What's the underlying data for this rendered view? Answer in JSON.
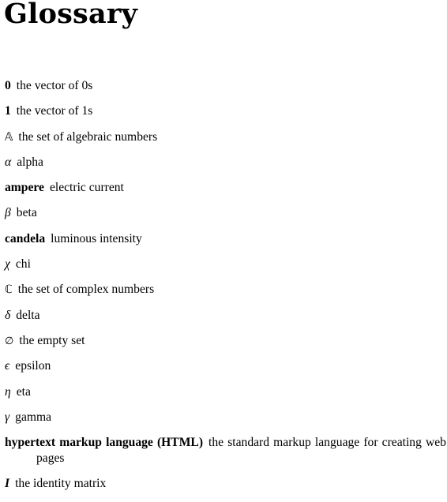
{
  "title": "Glossary",
  "entries": [
    {
      "term": "0",
      "description": "the vector of 0s",
      "style": "bold"
    },
    {
      "term": "1",
      "description": "the vector of 1s",
      "style": "bold"
    },
    {
      "term": "𝔸",
      "description": "the set of algebraic numbers",
      "style": "bb"
    },
    {
      "term": "α",
      "description": "alpha",
      "style": "math"
    },
    {
      "term": "ampere",
      "description": "electric current",
      "style": "bold"
    },
    {
      "term": "β",
      "description": "beta",
      "style": "math"
    },
    {
      "term": "candela",
      "description": "luminous intensity",
      "style": "bold"
    },
    {
      "term": "χ",
      "description": "chi",
      "style": "math"
    },
    {
      "term": "ℂ",
      "description": "the set of complex numbers",
      "style": "bb"
    },
    {
      "term": "δ",
      "description": "delta",
      "style": "math"
    },
    {
      "term": "∅",
      "description": "the empty set",
      "style": "sym"
    },
    {
      "term": "ϵ",
      "description": "epsilon",
      "style": "math"
    },
    {
      "term": "η",
      "description": "eta",
      "style": "math"
    },
    {
      "term": "γ",
      "description": "gamma",
      "style": "math"
    },
    {
      "term": "hypertext markup language (HTML)",
      "description": "the standard markup language for creating web pages",
      "style": "bold"
    },
    {
      "term": "I",
      "description": "the identity matrix",
      "style": "bold-italic"
    }
  ]
}
